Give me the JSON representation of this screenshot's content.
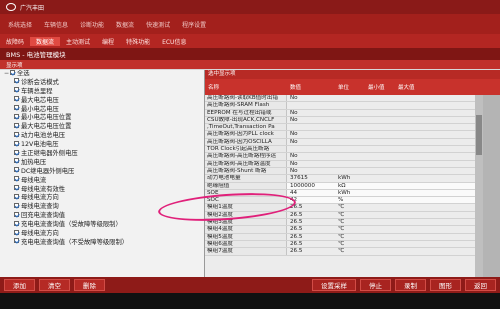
{
  "brand": {
    "title": "广汽丰田"
  },
  "top_tabs": [
    "系统选择",
    "车辆信息",
    "诊断功能",
    "数据流",
    "快速测试",
    "程序设置"
  ],
  "sub_tabs": [
    "故障码",
    "数据流",
    "主动测试",
    "编程",
    "特殊功能",
    "ECU信息"
  ],
  "module_title": "BMS - 电池管理模块",
  "section_label": "显示项",
  "tree": {
    "root_label": "全选",
    "items": [
      "诊断会话模式",
      "车辆总里程",
      "最大电芯电压",
      "最小电芯电压",
      "最小电芯电压位置",
      "最大电芯电压位置",
      "动力电池总电压",
      "12V电池电压",
      "主正继电器外侧电压",
      "加热电压",
      "DC继电器外侧电压",
      "母线电流",
      "母线电流有效性",
      "母线电流方向",
      "母线电流查询",
      "回充电流查询值",
      "充电电流查询值（受故障等级限制）",
      "母线电流方向",
      "充电电流查询值（不受故障等级限制）"
    ]
  },
  "right_panel": {
    "title": "选中显示项",
    "columns": {
      "name": "名称",
      "value": "数值",
      "unit": "单位",
      "min": "最小值",
      "max": "最大值"
    },
    "rows": [
      {
        "name": "高压断路阀-读取KB值时出错",
        "value": "No",
        "unit": ""
      },
      {
        "name": "高压断路阀-SRAM Flash",
        "value": "",
        "unit": ""
      },
      {
        "name": "EEPROM 在写过程出错或",
        "value": "No",
        "unit": ""
      },
      {
        "name": "CSU故障-出现ACK,CNCLF",
        "value": "No",
        "unit": ""
      },
      {
        "name": ",TimeOut,Transaction Pa",
        "value": "",
        "unit": ""
      },
      {
        "name": "高压断路阀-因为PLL clock",
        "value": "No",
        "unit": ""
      },
      {
        "name": "高压断路阀-因为OSCILLA",
        "value": "No",
        "unit": ""
      },
      {
        "name": "TOR Clock引起高压断路",
        "value": "",
        "unit": ""
      },
      {
        "name": "高压断路阀-高压断路程序运",
        "value": "No",
        "unit": ""
      },
      {
        "name": "高压断路阀-高压断路温度",
        "value": "No",
        "unit": ""
      },
      {
        "name": "高压断路阀-Shunt 断路",
        "value": "No",
        "unit": ""
      },
      {
        "name": "动力电池电量",
        "value": "37615",
        "unit": "kWh"
      },
      {
        "name": "绝缘阻值",
        "value": "1000000",
        "unit": "kΩ"
      },
      {
        "name": "SOE",
        "value": "44",
        "unit": "kWh"
      },
      {
        "name": "SOC",
        "value": "42",
        "unit": "%"
      },
      {
        "name": "模组1温度",
        "value": "26.5",
        "unit": "℃"
      },
      {
        "name": "模组2温度",
        "value": "26.5",
        "unit": "℃"
      },
      {
        "name": "模组3温度",
        "value": "26.5",
        "unit": "℃"
      },
      {
        "name": "模组4温度",
        "value": "26.5",
        "unit": "℃"
      },
      {
        "name": "模组5温度",
        "value": "26.5",
        "unit": "℃"
      },
      {
        "name": "模组6温度",
        "value": "26.5",
        "unit": "℃"
      },
      {
        "name": "模组7温度",
        "value": "26.5",
        "unit": "℃"
      }
    ]
  },
  "bottom_buttons": {
    "add": "添加",
    "clear": "清空",
    "delete": "删除",
    "settings": "设置采样",
    "stop": "停止",
    "record": "录制",
    "graph": "图形",
    "back": "返回"
  },
  "colors": {
    "accent": "#c0312b",
    "annotation": "#e0207a"
  }
}
